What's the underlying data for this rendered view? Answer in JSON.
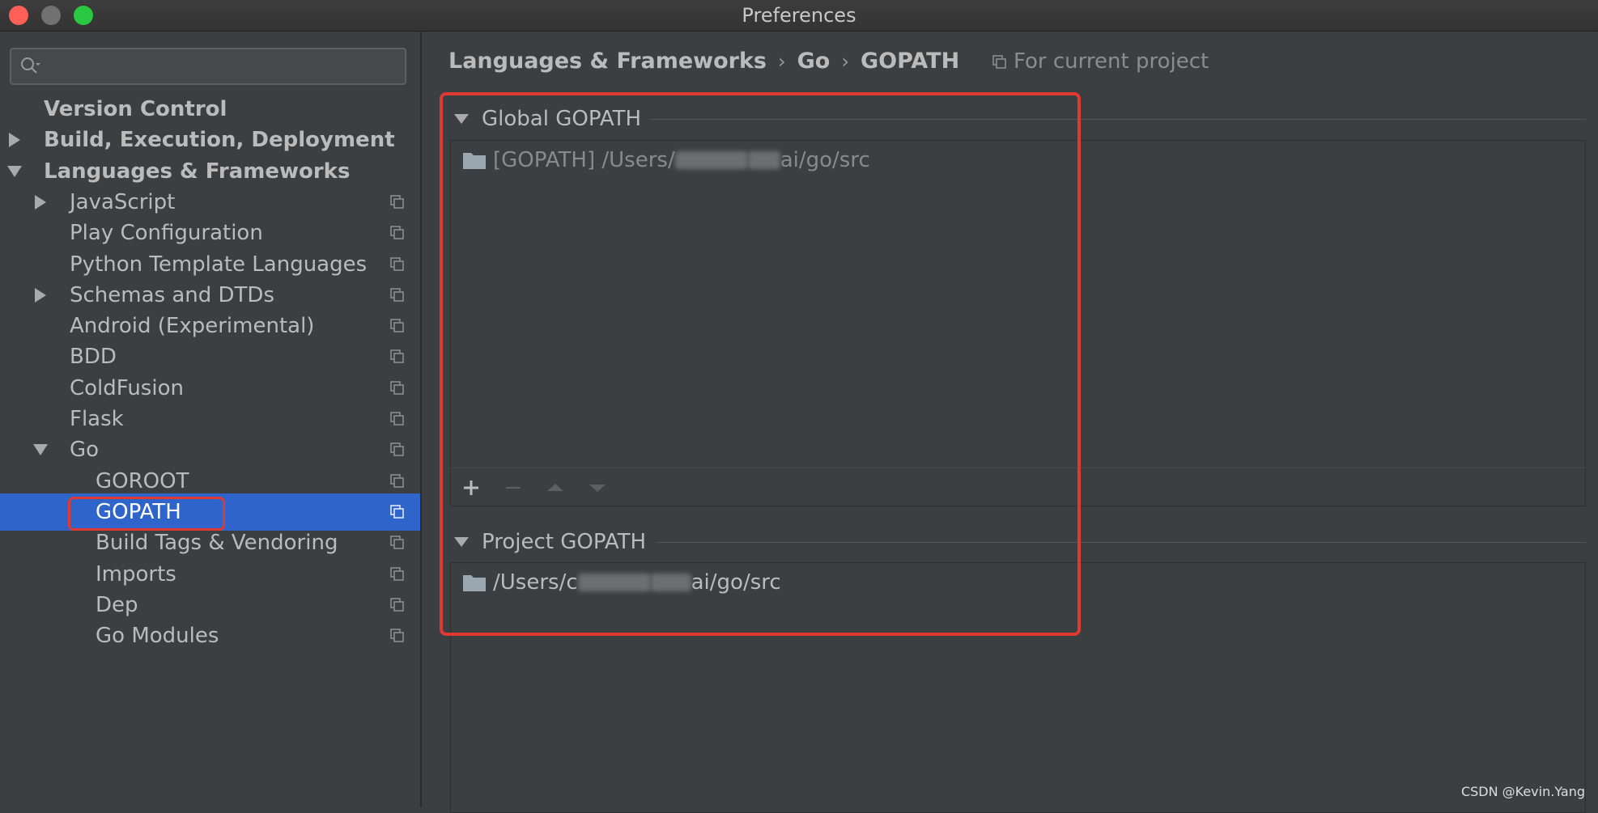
{
  "window": {
    "title": "Preferences"
  },
  "search": {
    "placeholder": ""
  },
  "sidebar": {
    "items": [
      {
        "label": "Version Control",
        "level": 0,
        "bold": true,
        "expander": "none",
        "project_scoped": false
      },
      {
        "label": "Build, Execution, Deployment",
        "level": 0,
        "bold": true,
        "expander": "collapsed",
        "project_scoped": false
      },
      {
        "label": "Languages & Frameworks",
        "level": 0,
        "bold": true,
        "expander": "expanded",
        "project_scoped": false
      },
      {
        "label": "JavaScript",
        "level": 1,
        "bold": false,
        "expander": "collapsed",
        "project_scoped": true
      },
      {
        "label": "Play Configuration",
        "level": 1,
        "bold": false,
        "expander": "none",
        "project_scoped": true
      },
      {
        "label": "Python Template Languages",
        "level": 1,
        "bold": false,
        "expander": "none",
        "project_scoped": true
      },
      {
        "label": "Schemas and DTDs",
        "level": 1,
        "bold": false,
        "expander": "collapsed",
        "project_scoped": true
      },
      {
        "label": "Android (Experimental)",
        "level": 1,
        "bold": false,
        "expander": "none",
        "project_scoped": true
      },
      {
        "label": "BDD",
        "level": 1,
        "bold": false,
        "expander": "none",
        "project_scoped": true
      },
      {
        "label": "ColdFusion",
        "level": 1,
        "bold": false,
        "expander": "none",
        "project_scoped": true
      },
      {
        "label": "Flask",
        "level": 1,
        "bold": false,
        "expander": "none",
        "project_scoped": true
      },
      {
        "label": "Go",
        "level": 1,
        "bold": false,
        "expander": "expanded",
        "project_scoped": true
      },
      {
        "label": "GOROOT",
        "level": 2,
        "bold": false,
        "expander": "none",
        "project_scoped": true
      },
      {
        "label": "GOPATH",
        "level": 2,
        "bold": false,
        "expander": "none",
        "project_scoped": true,
        "selected": true
      },
      {
        "label": "Build Tags & Vendoring",
        "level": 2,
        "bold": false,
        "expander": "none",
        "project_scoped": true
      },
      {
        "label": "Imports",
        "level": 2,
        "bold": false,
        "expander": "none",
        "project_scoped": true
      },
      {
        "label": "Dep",
        "level": 2,
        "bold": false,
        "expander": "none",
        "project_scoped": true
      },
      {
        "label": "Go Modules",
        "level": 2,
        "bold": false,
        "expander": "none",
        "project_scoped": true
      }
    ]
  },
  "breadcrumb": {
    "parts": [
      "Languages & Frameworks",
      "Go",
      "GOPATH"
    ],
    "separator": "›",
    "scope_label": "For current project"
  },
  "global_gopath": {
    "title": "Global GOPATH",
    "entries": [
      {
        "prefix": "[GOPATH] /Users/",
        "suffix": "ai/go/src"
      }
    ]
  },
  "project_gopath": {
    "title": "Project GOPATH",
    "entries": [
      {
        "prefix": "/Users/c",
        "suffix": "ai/go/src"
      }
    ]
  },
  "toolbar": {
    "add": "+",
    "remove": "−"
  },
  "watermark": "CSDN @Kevin.Yang",
  "colors": {
    "selection": "#2f65ca",
    "highlight_red": "#e0392f",
    "background": "#3c3f41"
  }
}
